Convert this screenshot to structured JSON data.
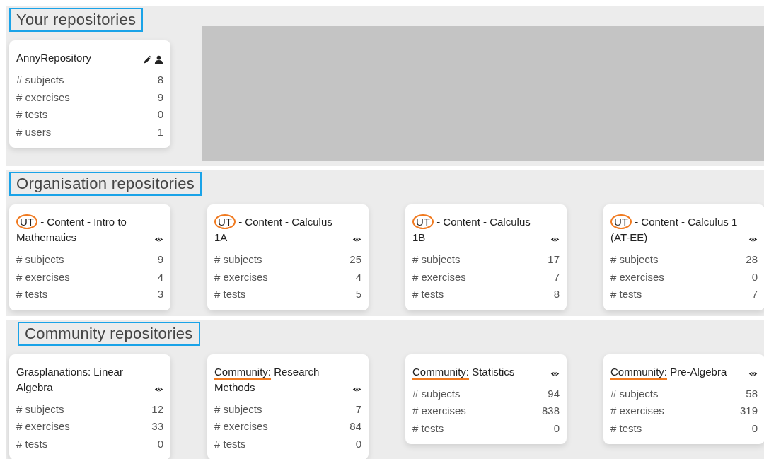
{
  "sections": [
    {
      "heading": "Your repositories",
      "heading_boxed": true,
      "redacted_panel": true,
      "cards": [
        {
          "title": [
            "AnnyRepository"
          ],
          "editable": true,
          "owned": true,
          "stats": [
            {
              "label": "# subjects",
              "value": "8"
            },
            {
              "label": "# exercises",
              "value": "9"
            },
            {
              "label": "# tests",
              "value": "0"
            },
            {
              "label": "# users",
              "value": "1"
            }
          ]
        }
      ]
    },
    {
      "heading": "Organisation repositories",
      "heading_boxed": true,
      "cards": [
        {
          "title": [
            "UT",
            " - Content - Intro to Mathematics"
          ],
          "prefix_circled": true,
          "viewable": true,
          "stats": [
            {
              "label": "# subjects",
              "value": "9"
            },
            {
              "label": "# exercises",
              "value": "4"
            },
            {
              "label": "# tests",
              "value": "3"
            }
          ]
        },
        {
          "title": [
            "UT",
            " - Content - Calculus 1A"
          ],
          "prefix_circled": true,
          "viewable": true,
          "stats": [
            {
              "label": "# subjects",
              "value": "25"
            },
            {
              "label": "# exercises",
              "value": "4"
            },
            {
              "label": "# tests",
              "value": "5"
            }
          ]
        },
        {
          "title": [
            "UT",
            " - Content - Calculus 1B"
          ],
          "prefix_circled": true,
          "viewable": true,
          "stats": [
            {
              "label": "# subjects",
              "value": "17"
            },
            {
              "label": "# exercises",
              "value": "7"
            },
            {
              "label": "# tests",
              "value": "8"
            }
          ]
        },
        {
          "title": [
            "UT",
            " - Content - Calculus 1 (AT-EE)"
          ],
          "prefix_circled": true,
          "viewable": true,
          "stats": [
            {
              "label": "# subjects",
              "value": "28"
            },
            {
              "label": "# exercises",
              "value": "0"
            },
            {
              "label": "# tests",
              "value": "7"
            }
          ]
        }
      ]
    },
    {
      "heading": "Community repositories",
      "heading_boxed": true,
      "cards": [
        {
          "title": [
            "Grasplanations: Linear Algebra"
          ],
          "viewable": true,
          "stats": [
            {
              "label": "# subjects",
              "value": "12"
            },
            {
              "label": "# exercises",
              "value": "33"
            },
            {
              "label": "# tests",
              "value": "0"
            }
          ]
        },
        {
          "title": [
            "Community:",
            " Research Methods"
          ],
          "prefix_underlined": true,
          "viewable": true,
          "stats": [
            {
              "label": "# subjects",
              "value": "7"
            },
            {
              "label": "# exercises",
              "value": "84"
            },
            {
              "label": "# tests",
              "value": "0"
            }
          ]
        },
        {
          "title": [
            "Community:",
            " Statistics"
          ],
          "prefix_underlined": true,
          "viewable": true,
          "stats": [
            {
              "label": "# subjects",
              "value": "94"
            },
            {
              "label": "# exercises",
              "value": "838"
            },
            {
              "label": "# tests",
              "value": "0"
            }
          ]
        },
        {
          "title": [
            "Community:",
            " Pre-Algebra"
          ],
          "prefix_underlined": true,
          "viewable": true,
          "stats": [
            {
              "label": "# subjects",
              "value": "58"
            },
            {
              "label": "# exercises",
              "value": "319"
            },
            {
              "label": "# tests",
              "value": "0"
            }
          ]
        }
      ]
    }
  ]
}
